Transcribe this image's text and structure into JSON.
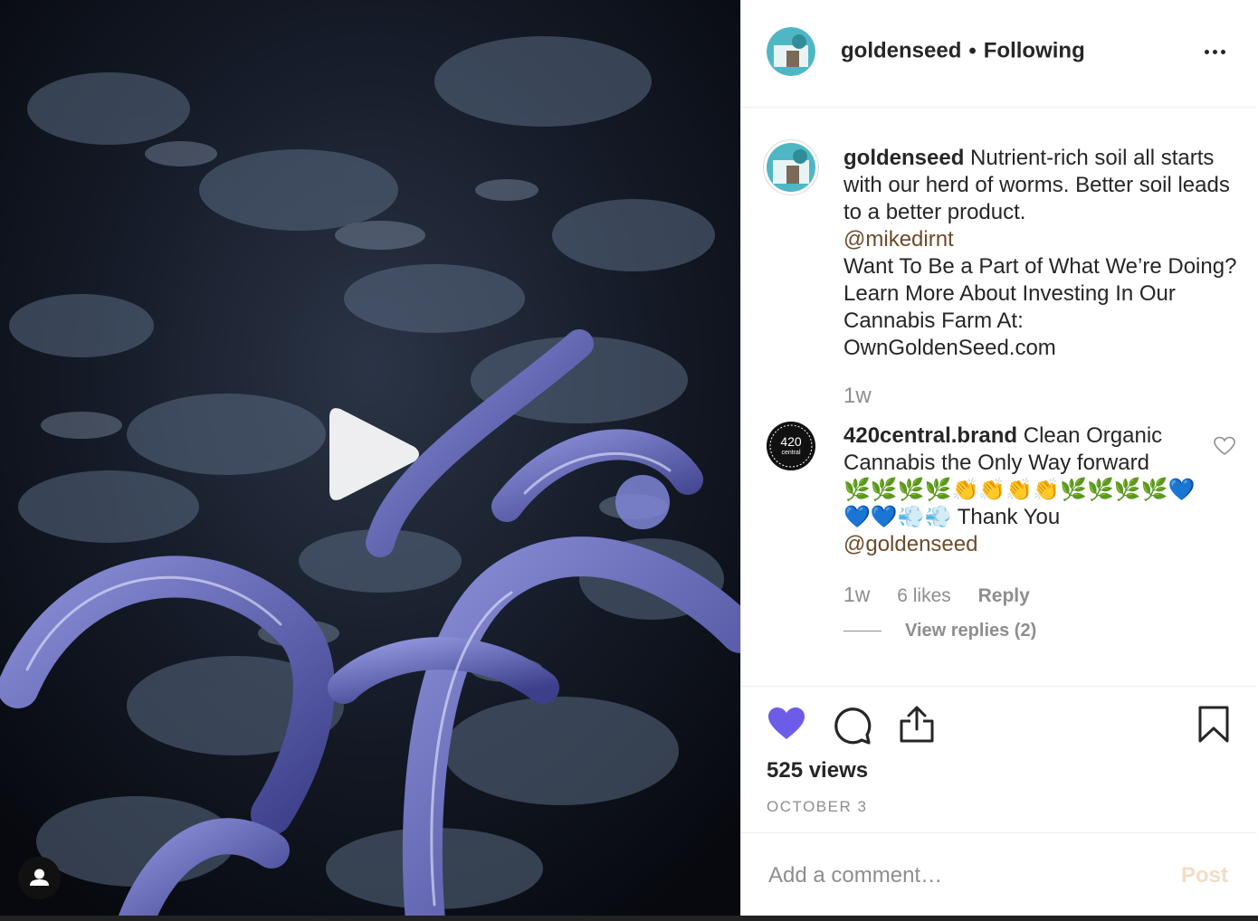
{
  "post": {
    "author": "goldenseed",
    "separator": "•",
    "follow_status": "Following"
  },
  "caption": {
    "username": "goldenseed",
    "text": "Nutrient-rich soil all starts with our herd of worms. Better soil leads to a better product.",
    "mention": "@mikedirnt",
    "text2": "Want To Be a Part of What We’re Doing? Learn More About Investing In Our Cannabis Farm At: OwnGoldenSeed.com",
    "time": "1w"
  },
  "comment": {
    "avatar_text_top": "420",
    "avatar_text_bottom": "central",
    "username": "420central.brand",
    "text": "Clean Organic Cannabis the Only Way forward",
    "emojis": "🌿🌿🌿🌿👏👏👏👏🌿🌿🌿🌿💙💙💙💨💨",
    "text_after_emojis": "Thank You",
    "mention": "@goldenseed",
    "time": "1w",
    "likes": "6 likes",
    "reply_label": "Reply",
    "view_replies": "View replies (2)"
  },
  "stats": {
    "views": "525 views",
    "date": "OCTOBER 3"
  },
  "composer": {
    "placeholder": "Add a comment…",
    "post_label": "Post"
  },
  "colors": {
    "like_active": "#6c5ce7",
    "mention": "#6b4b2a",
    "post_disabled": "#f3dcc6",
    "muted": "#8e8e8e"
  },
  "icons": {
    "play": "play-icon",
    "user_tag": "user-icon",
    "more": "more-options-icon",
    "like": "heart-icon",
    "comment": "comment-icon",
    "share": "share-icon",
    "save": "bookmark-icon",
    "comment_like": "heart-outline-icon"
  }
}
